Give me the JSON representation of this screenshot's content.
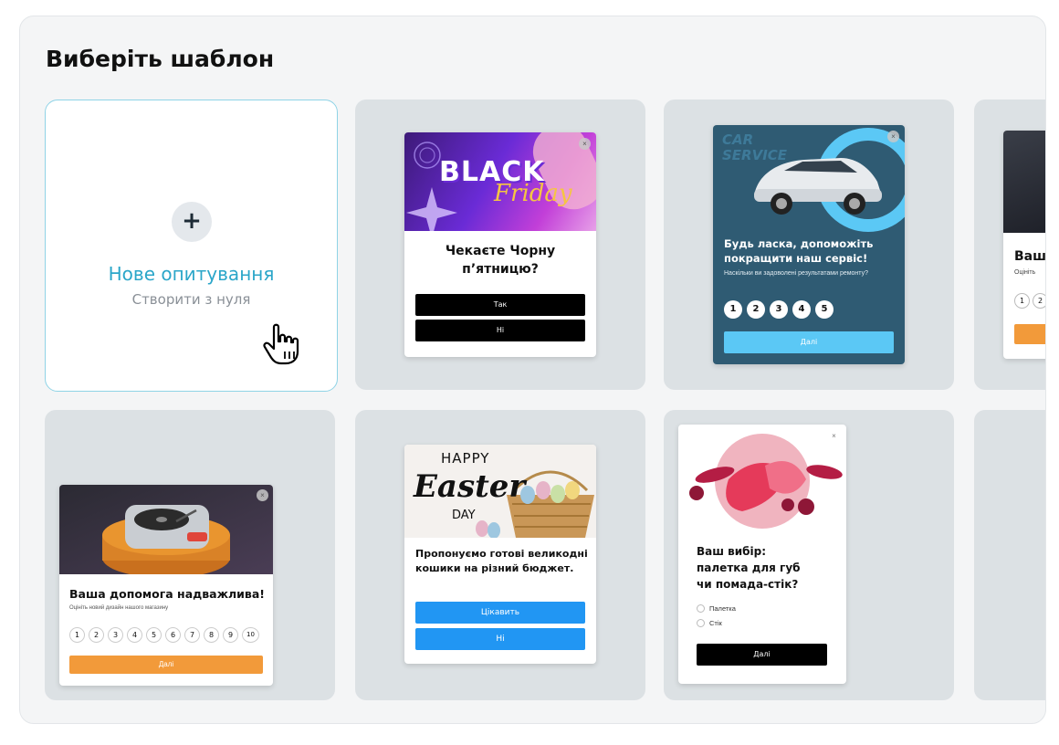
{
  "panel": {
    "title": "Виберіть шаблон"
  },
  "new_survey": {
    "title": "Нове опитування",
    "subtitle": "Створити з нуля",
    "plus": "+"
  },
  "templates": {
    "black_friday": {
      "banner_line1": "BLACK",
      "banner_line2": "Friday",
      "question": "Чекаєте Чорну п’ятницю?",
      "answers": [
        "Так",
        "Ні"
      ]
    },
    "car_service": {
      "banner_text": "CAR SERVICE",
      "question": "Будь ласка, допоможіть покращити наш сервіс!",
      "subtext": "Наскільки ви задоволені результатами ремонту?",
      "scale": [
        "1",
        "2",
        "3",
        "4",
        "5"
      ],
      "button": "Далі"
    },
    "partial_card": {
      "title": "Ваш",
      "subtext": "Оцініть",
      "scale": [
        "1",
        "2"
      ]
    },
    "turntable": {
      "question": "Ваша допомога надважлива!",
      "subtext": "Оцініть новий дизайн нашого магазину",
      "scale": [
        "1",
        "2",
        "3",
        "4",
        "5",
        "6",
        "7",
        "8",
        "9",
        "10"
      ],
      "button": "Далі"
    },
    "easter": {
      "banner_line1": "HAPPY",
      "banner_line2": "Easter",
      "banner_line3": "DAY",
      "question": "Пропонуємо готові великодні кошики на різний бюджет.",
      "answers": [
        "Цікавить",
        "Ні"
      ]
    },
    "lipstick": {
      "question": "Ваш вибір: палетка для губ чи помада-стік?",
      "options": [
        "Палетка",
        "Стік"
      ],
      "button": "Далі"
    }
  },
  "colors": {
    "accent": "#2ba6c9",
    "tile_bg": "#dce1e4",
    "car_card_bg": "#2f5b73",
    "car_button": "#5bc8f5",
    "orange_button": "#f29a3a",
    "blue_button": "#2196f3"
  },
  "icons": [
    "plus-icon",
    "hand-cursor-icon",
    "close-icon"
  ]
}
